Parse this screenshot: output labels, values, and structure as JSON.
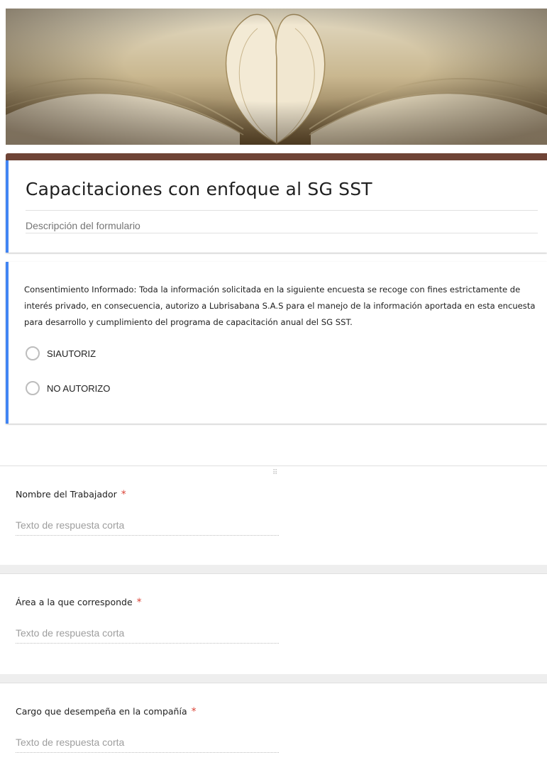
{
  "header": {
    "image_name": "open-book-heart-pages-image"
  },
  "form": {
    "title": "Capacitaciones con enfoque al SG SST",
    "description_placeholder": "Descripción del formulario"
  },
  "consent": {
    "text": "Consentimiento Informado: Toda la información solicitada en la siguiente encuesta se recoge con fines estrictamente de interés privado, en consecuencia, autorizo a Lubrisabana S.A.S para el manejo de la información aportada en esta encuesta para desarrollo y cumplimiento del  programa de capacitación anual del SG SST.",
    "options": [
      {
        "label": "SIAUTORIZ"
      },
      {
        "label": "NO AUTORIZO"
      }
    ]
  },
  "questions": [
    {
      "label": "Nombre del Trabajador",
      "required_mark": "*",
      "placeholder": "Texto de respuesta corta"
    },
    {
      "label": "Área a la que corresponde",
      "required_mark": "*",
      "placeholder": "Texto de respuesta corta"
    },
    {
      "label": "Cargo que desempeña en la compañía",
      "required_mark": "*",
      "placeholder": "Texto de respuesta corta"
    }
  ],
  "drag_handle_icon": "drag-handle-icon",
  "colors": {
    "accent_bar": "#6f4436",
    "selected_card_border": "#4285f4",
    "required_star": "#db4437"
  }
}
